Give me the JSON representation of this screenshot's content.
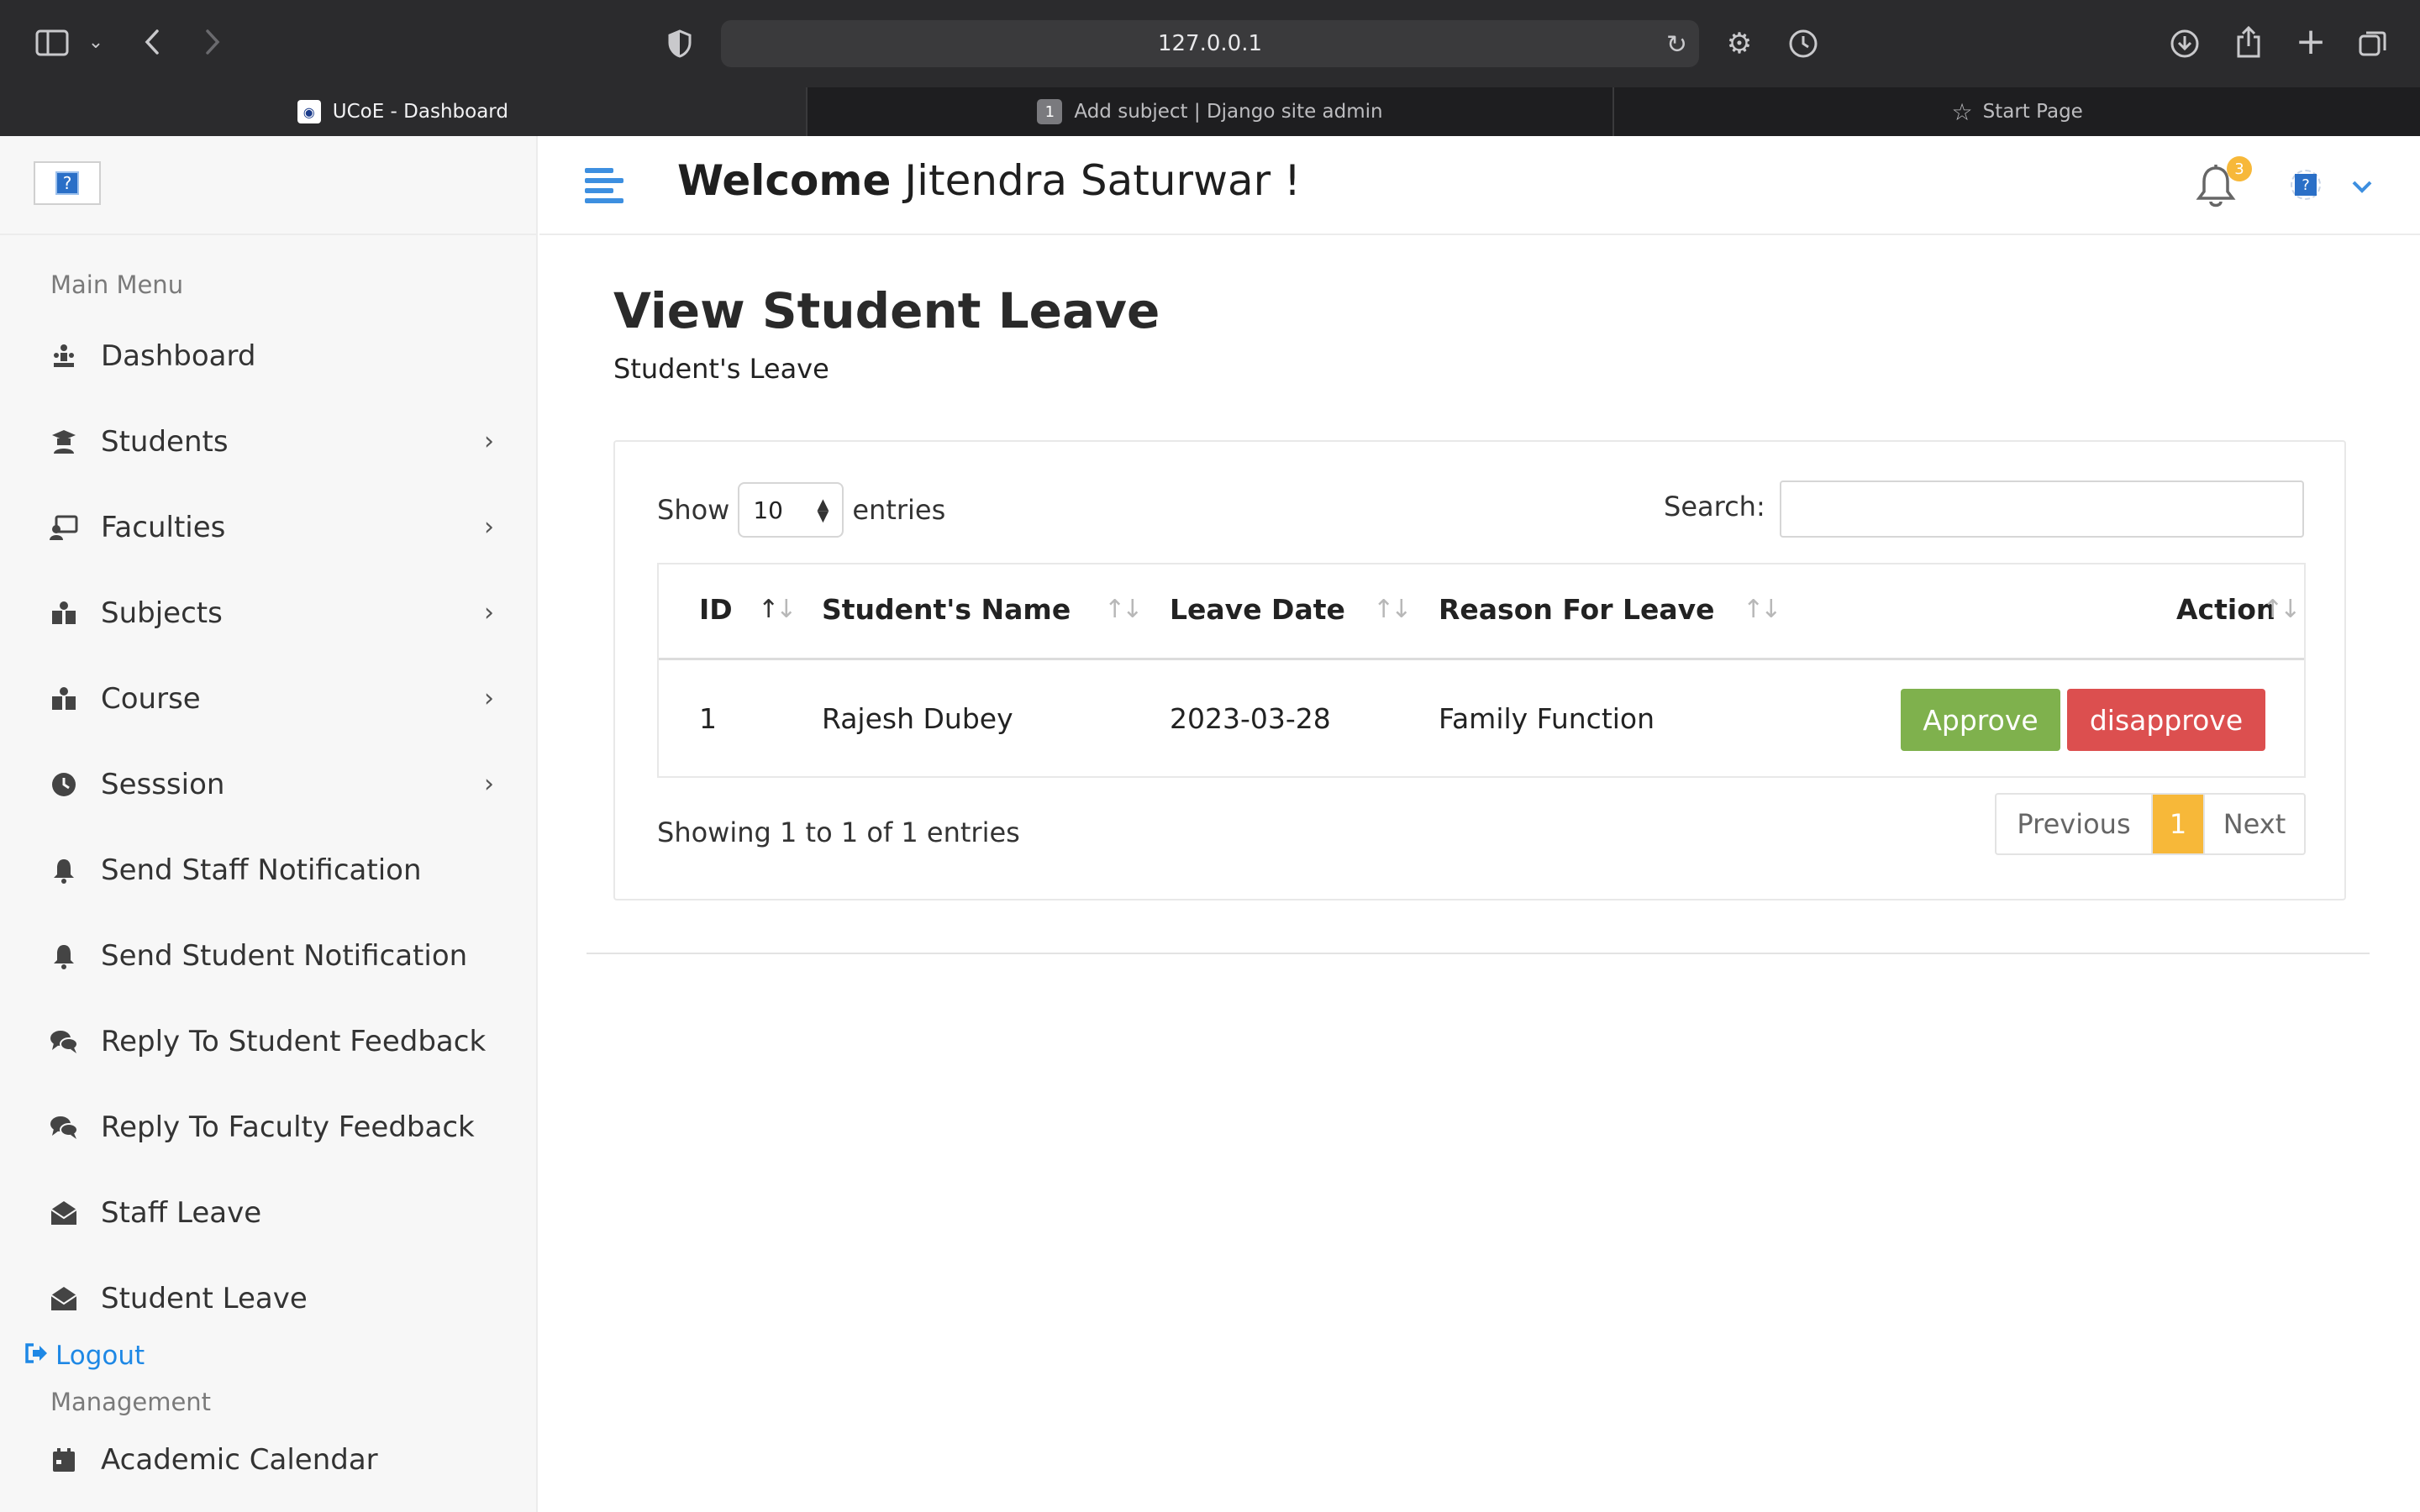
{
  "browser": {
    "url": "127.0.0.1",
    "tabs": [
      {
        "label": "UCoE - Dashboard",
        "active": true
      },
      {
        "label": "Add subject | Django site admin",
        "badge": "1"
      },
      {
        "label": "Start Page"
      }
    ]
  },
  "sidebar": {
    "main_menu_title": "Main Menu",
    "items": [
      {
        "label": "Dashboard",
        "icon": "dashboard-icon",
        "has_submenu": false
      },
      {
        "label": "Students",
        "icon": "student-icon",
        "has_submenu": true
      },
      {
        "label": "Faculties",
        "icon": "faculty-icon",
        "has_submenu": true
      },
      {
        "label": "Subjects",
        "icon": "subject-icon",
        "has_submenu": true
      },
      {
        "label": "Course",
        "icon": "course-icon",
        "has_submenu": true
      },
      {
        "label": "Sesssion",
        "icon": "clock-icon",
        "has_submenu": true
      },
      {
        "label": "Send Staff Notification",
        "icon": "bell-icon",
        "has_submenu": false
      },
      {
        "label": "Send Student Notification",
        "icon": "bell-icon",
        "has_submenu": false
      },
      {
        "label": "Reply To Student Feedback",
        "icon": "comments-icon",
        "has_submenu": false
      },
      {
        "label": "Reply To Faculty Feedback",
        "icon": "comments-icon",
        "has_submenu": false
      },
      {
        "label": "Staff Leave",
        "icon": "envelope-open-icon",
        "has_submenu": false
      },
      {
        "label": "Student Leave",
        "icon": "envelope-open-icon",
        "has_submenu": false
      }
    ],
    "logout_label": "Logout",
    "management_title": "Management",
    "academic_calendar_label": "Academic Calendar"
  },
  "header": {
    "welcome_bold": "Welcome",
    "user_name": "Jitendra Saturwar  !",
    "notification_count": "3"
  },
  "page": {
    "title": "View Student Leave",
    "subtitle": "Student's Leave"
  },
  "table_controls": {
    "show_label": "Show",
    "entries_value": "10",
    "entries_label": "entries",
    "search_label": "Search:",
    "search_value": ""
  },
  "table": {
    "columns": [
      "ID",
      "Student's Name",
      "Leave Date",
      "Reason For Leave",
      "Action"
    ],
    "rows": [
      {
        "id": "1",
        "name": "Rajesh Dubey",
        "date": "2023-03-28",
        "reason": "Family Function",
        "approve_label": "Approve",
        "disapprove_label": "disapprove"
      }
    ]
  },
  "footer": {
    "showing_text": "Showing 1 to 1 of 1 entries",
    "prev_label": "Previous",
    "current_page": "1",
    "next_label": "Next"
  },
  "colors": {
    "accent": "#3d8fe0",
    "approve": "#7fb14d",
    "disapprove": "#dc4f4f",
    "page_active": "#f7b839"
  }
}
